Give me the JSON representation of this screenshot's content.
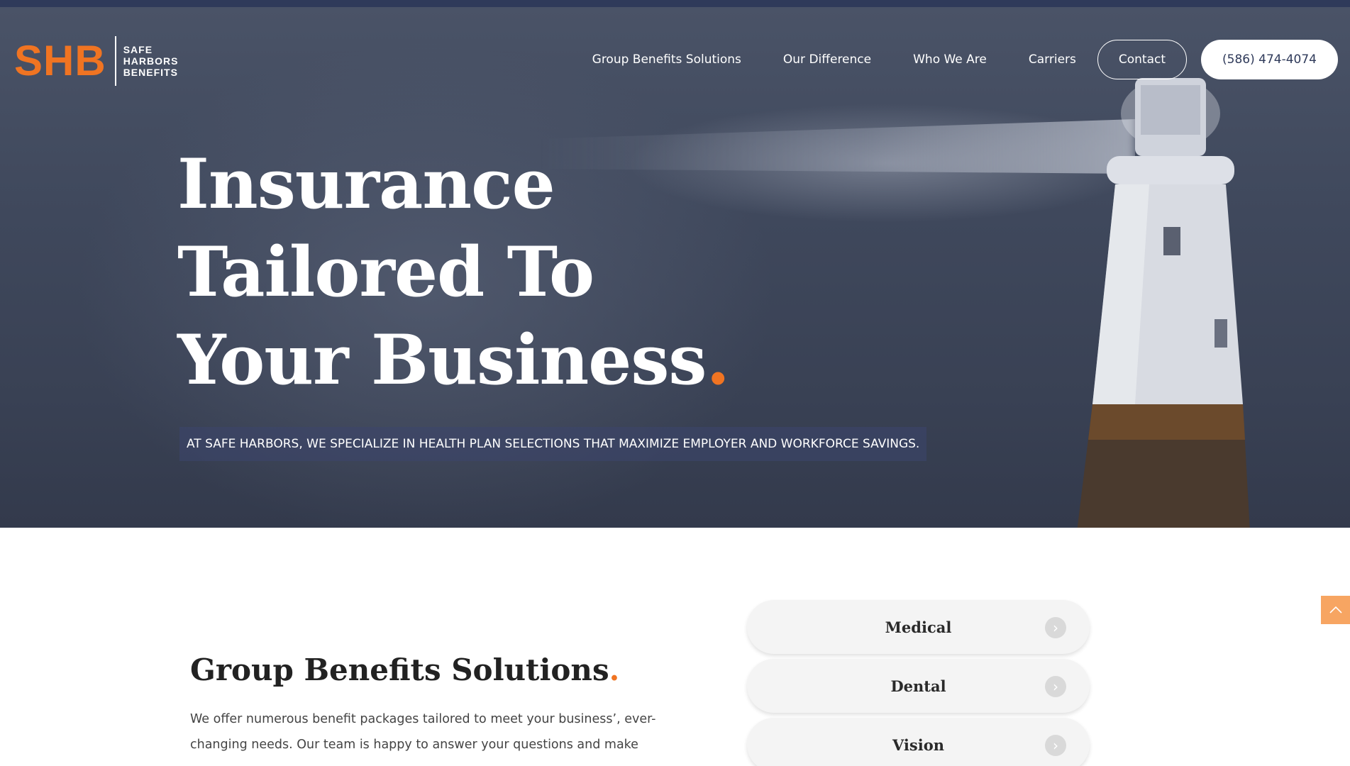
{
  "logo": {
    "mark": "SHB",
    "line1": "SAFE",
    "line2": "HARBORS",
    "line3": "BENEFITS"
  },
  "nav": {
    "items": [
      "Group Benefits Solutions",
      "Our Difference",
      "Who We Are",
      "Carriers"
    ],
    "contact_label": "Contact",
    "phone_label": "(586) 474-4074"
  },
  "hero": {
    "headline_line1": "Insurance",
    "headline_line2": "Tailored To",
    "headline_line3": "Your Business",
    "headline_dot": ".",
    "tagline": "AT SAFE HARBORS, WE SPECIALIZE IN HEALTH PLAN SELECTIONS THAT MAXIMIZE EMPLOYER AND WORKFORCE SAVINGS."
  },
  "section": {
    "title": "Group Benefits Solutions",
    "title_dot": ".",
    "body": "We offer numerous benefit packages tailored to meet your business’, ever-changing needs. Our team is happy to answer your questions and make"
  },
  "benefits": [
    "Medical",
    "Dental",
    "Vision"
  ],
  "icons": {
    "benefit_arrow": "chevron-right-icon",
    "scroll_top": "chevron-up-icon"
  },
  "colors": {
    "accent": "#f07422",
    "nav_bar": "#2f3a5a",
    "hero_bg": "#3f485c"
  }
}
